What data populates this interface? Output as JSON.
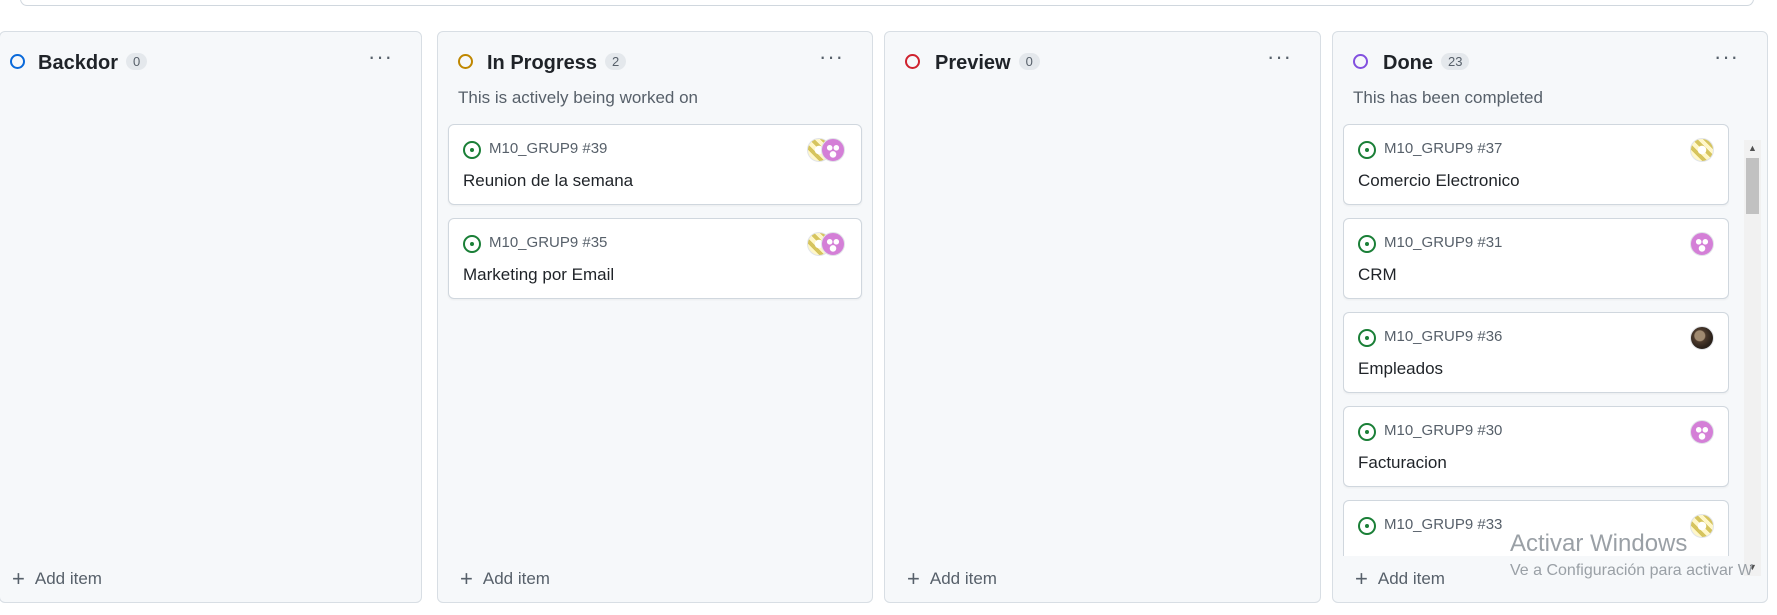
{
  "columns": [
    {
      "title": "Backdor",
      "count": "0",
      "status_color": "#0969da",
      "description": "",
      "cards": [],
      "add_label": "Add item"
    },
    {
      "title": "In Progress",
      "count": "2",
      "status_color": "#bf8700",
      "description": "This is actively being worked on",
      "cards": [
        {
          "ref": "M10_GRUP9 #39",
          "title": "Reunion de la semana",
          "avatars": [
            "yellow",
            "pink"
          ]
        },
        {
          "ref": "M10_GRUP9 #35",
          "title": "Marketing por Email",
          "avatars": [
            "yellow",
            "pink"
          ]
        }
      ],
      "add_label": "Add item"
    },
    {
      "title": "Preview",
      "count": "0",
      "status_color": "#cf222e",
      "description": "",
      "cards": [],
      "add_label": "Add item"
    },
    {
      "title": "Done",
      "count": "23",
      "status_color": "#8250df",
      "description": "This has been completed",
      "cards": [
        {
          "ref": "M10_GRUP9 #37",
          "title": "Comercio Electronico",
          "avatars": [
            "yellow"
          ]
        },
        {
          "ref": "M10_GRUP9 #31",
          "title": "CRM",
          "avatars": [
            "pink"
          ]
        },
        {
          "ref": "M10_GRUP9 #36",
          "title": "Empleados",
          "avatars": [
            "photo"
          ]
        },
        {
          "ref": "M10_GRUP9 #30",
          "title": "Facturacion",
          "avatars": [
            "pink"
          ]
        },
        {
          "ref": "M10_GRUP9 #33",
          "title": "",
          "avatars": [
            "yellow"
          ]
        }
      ],
      "add_label": "Add item"
    }
  ],
  "more_icon": "kebab-horizontal-icon",
  "issue_icon": "issue-open-icon",
  "issue_color": "#1a7f37",
  "watermark": {
    "line1": "Activar Windows",
    "line2": "Ve a Configuración para activar W"
  }
}
